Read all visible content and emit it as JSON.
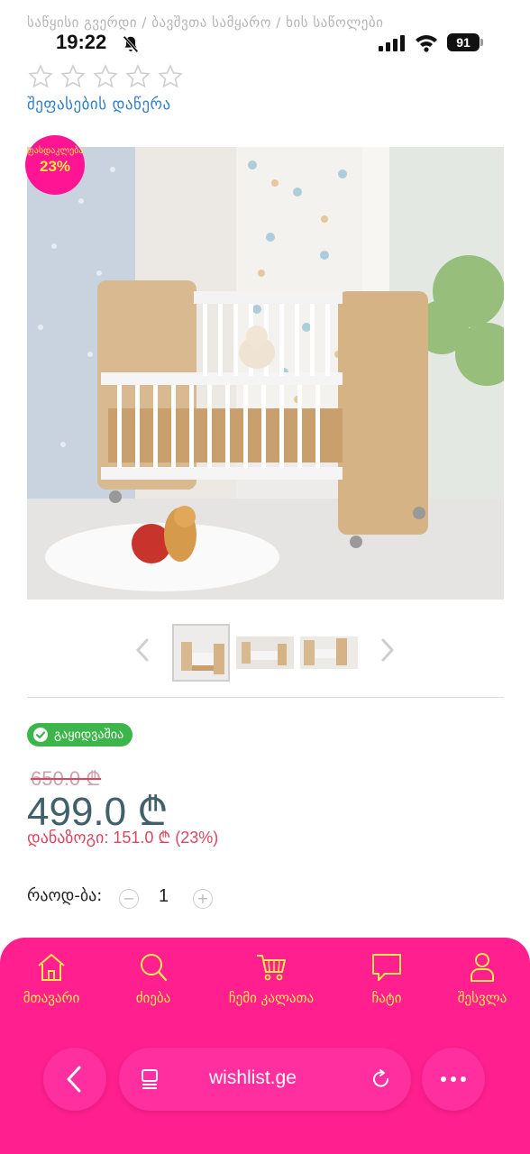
{
  "breadcrumb": "საწყისი გვერდი / ბავშვთა სამყარო / ხის საწოლები",
  "status_bar": {
    "time": "19:22",
    "battery": "91"
  },
  "rating": {
    "stars": 0,
    "max": 5,
    "write_review": "შეფასების დაწერა"
  },
  "badge": {
    "label": "ფასდაკლება",
    "percent": "23%"
  },
  "stock": "გაყიდვაშია",
  "price": {
    "old": "650.0 ₾",
    "new": "499.0 ₾",
    "saving": "დანაზოგი: 151.0 ₾ (23%)"
  },
  "quantity": {
    "label": "რაოდ-ბა:",
    "value": "1",
    "minus": "−",
    "plus": "+"
  },
  "nav": {
    "home": "მთავარი",
    "search": "ძიება",
    "cart": "ჩემი კალათა",
    "chat": "ჩატი",
    "login": "შესვლა"
  },
  "browser": {
    "url": "wishlist.ge"
  },
  "colors": {
    "accent": "#ff1f8e",
    "nav_text": "#ffe94d",
    "price": "#40606a",
    "discount": "#e0455f",
    "in_stock": "#3cb54a"
  }
}
